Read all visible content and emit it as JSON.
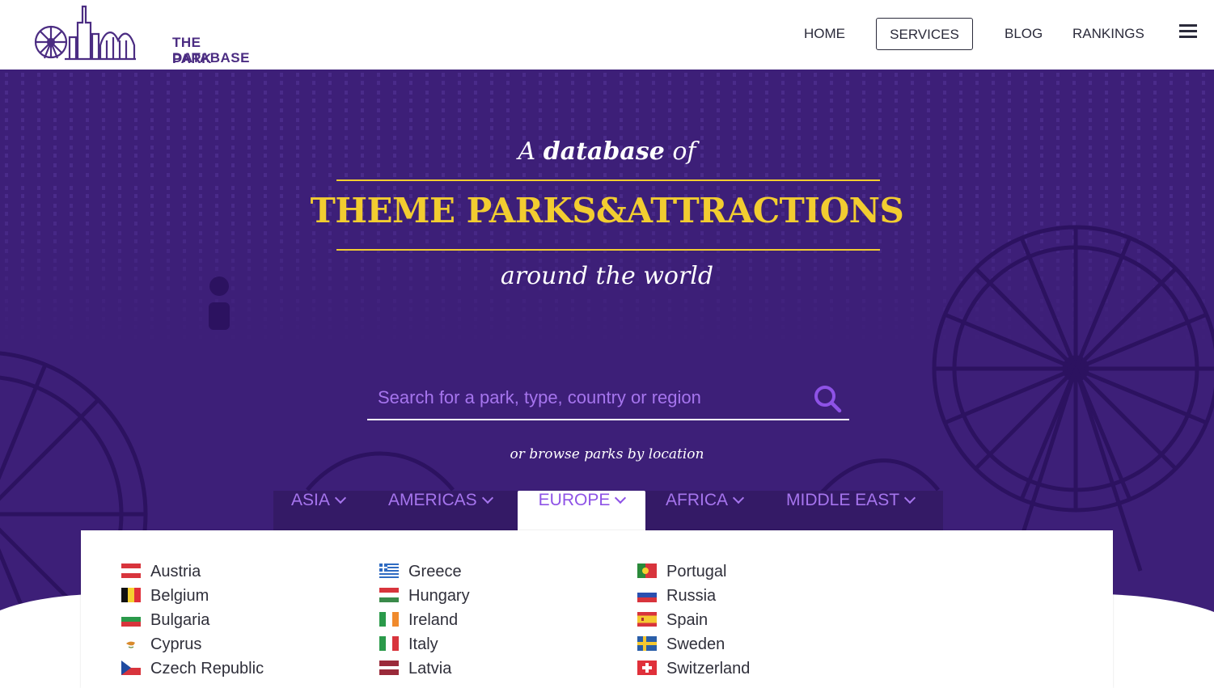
{
  "header": {
    "logo": {
      "line1": "THE PARK",
      "line2": "DATABASE"
    },
    "nav": [
      {
        "id": "home",
        "label": "HOME"
      },
      {
        "id": "services",
        "label": "SERVICES"
      },
      {
        "id": "blog",
        "label": "BLOG"
      },
      {
        "id": "rankings",
        "label": "RANKINGS"
      }
    ],
    "menu_icon": "hamburger-icon"
  },
  "hero": {
    "title_prefix": "A",
    "title_bold": "database",
    "title_suffix": "of",
    "title_main": "THEME PARKS&ATTRACTIONS",
    "title_sub": "around the world",
    "search_placeholder": "Search for a park, type, country or region",
    "search_icon": "search-icon",
    "browse_text": "or browse parks by location"
  },
  "tabs": [
    {
      "label": "ASIA",
      "active": false
    },
    {
      "label": "AMERICAS",
      "active": false
    },
    {
      "label": "EUROPE",
      "active": true
    },
    {
      "label": "AFRICA",
      "active": false
    },
    {
      "label": "MIDDLE EAST",
      "active": false
    }
  ],
  "countries": [
    {
      "name": "Austria",
      "flag": "austria-flag-icon"
    },
    {
      "name": "Belgium",
      "flag": "belgium-flag-icon"
    },
    {
      "name": "Bulgaria",
      "flag": "bulgaria-flag-icon"
    },
    {
      "name": "Cyprus",
      "flag": "cyprus-flag-icon"
    },
    {
      "name": "Czech Republic",
      "flag": "czech-republic-flag-icon"
    },
    {
      "name": "Greece",
      "flag": "greece-flag-icon"
    },
    {
      "name": "Hungary",
      "flag": "hungary-flag-icon"
    },
    {
      "name": "Ireland",
      "flag": "ireland-flag-icon"
    },
    {
      "name": "Italy",
      "flag": "italy-flag-icon"
    },
    {
      "name": "Latvia",
      "flag": "latvia-flag-icon"
    },
    {
      "name": "Portugal",
      "flag": "portugal-flag-icon"
    },
    {
      "name": "Russia",
      "flag": "russia-flag-icon"
    },
    {
      "name": "Spain",
      "flag": "spain-flag-icon"
    },
    {
      "name": "Sweden",
      "flag": "sweden-flag-icon"
    },
    {
      "name": "Switzerland",
      "flag": "switzerland-flag-icon"
    }
  ],
  "colors": {
    "brand_purple": "#4b2c82",
    "hero_bg": "#3d1f78",
    "accent_yellow": "#f2cd30",
    "tab_text": "#a675ee",
    "tab_active_text": "#8e52e6"
  }
}
